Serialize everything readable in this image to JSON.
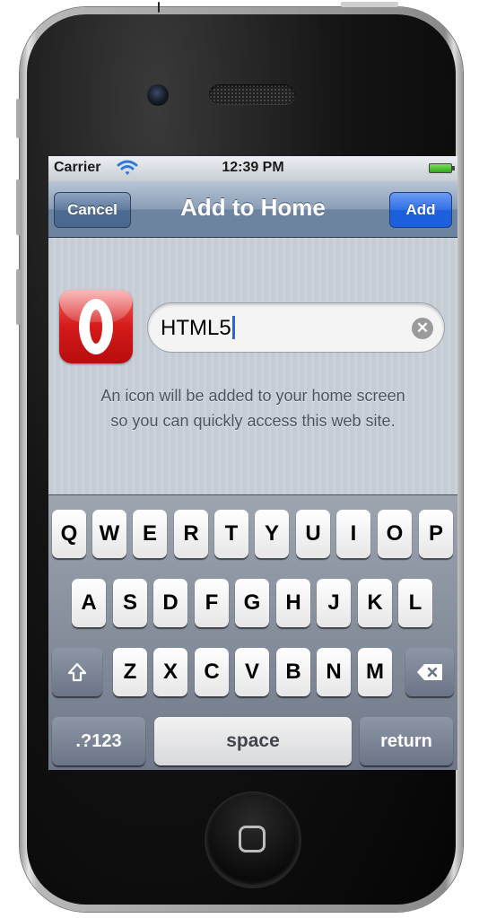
{
  "status_bar": {
    "carrier": "Carrier",
    "time": "12:39 PM",
    "wifi_icon": "wifi-icon",
    "battery_icon": "battery-icon"
  },
  "nav_bar": {
    "title": "Add to Home",
    "cancel_label": "Cancel",
    "add_label": "Add"
  },
  "bookmark": {
    "app_icon": "opera-icon",
    "name_value": "HTML5",
    "clear_icon": "clear-icon",
    "hint_line1": "An icon will be added to your home screen",
    "hint_line2": "so you can quickly access this web site."
  },
  "keyboard": {
    "row1": [
      "Q",
      "W",
      "E",
      "R",
      "T",
      "Y",
      "U",
      "I",
      "O",
      "P"
    ],
    "row2": [
      "A",
      "S",
      "D",
      "F",
      "G",
      "H",
      "J",
      "K",
      "L"
    ],
    "row3": [
      "Z",
      "X",
      "C",
      "V",
      "B",
      "N",
      "M"
    ],
    "shift_icon": "shift-icon",
    "backspace_icon": "backspace-icon",
    "numbers_label": ".?123",
    "space_label": "space",
    "return_label": "return"
  }
}
